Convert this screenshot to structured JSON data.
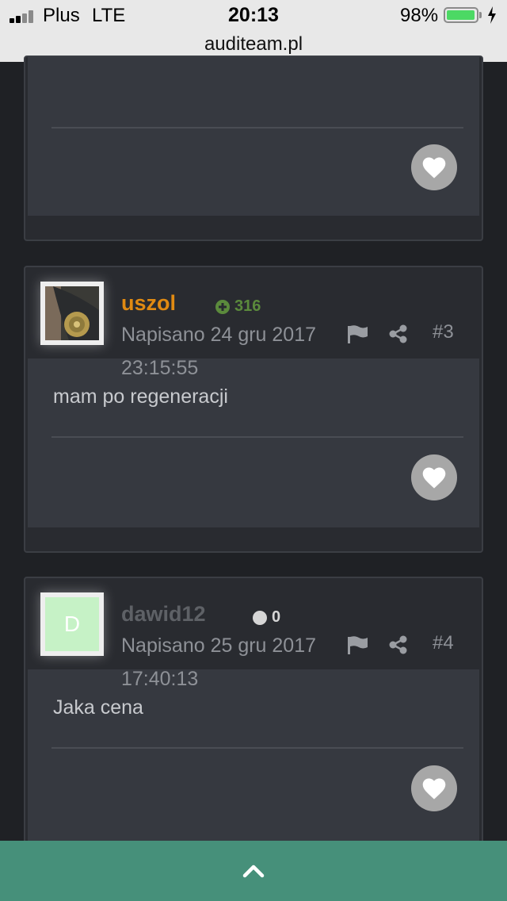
{
  "status_bar": {
    "carrier": "Plus",
    "network": "LTE",
    "time": "20:13",
    "battery_percent": "98%",
    "battery_level": 0.98,
    "battery_color": "#4cd964",
    "url": "auditeam.pl"
  },
  "posts": [
    {
      "id": "post-2",
      "content": ""
    },
    {
      "id": "post-3",
      "username": "uszol",
      "username_color": "#e08a12",
      "reputation": "316",
      "reputation_color": "#5b8a3c",
      "reputation_icon": "plus-circle-icon",
      "date_line1": "Napisano 24 gru 2017",
      "date_line2": "23:15:55",
      "number": "#3",
      "content": "mam po regeneracji",
      "avatar": "photo-avatar"
    },
    {
      "id": "post-4",
      "username": "dawid12",
      "username_color": "#5e6166",
      "reputation": "0",
      "reputation_color": "#d6d6d6",
      "reputation_icon": "neutral-dot-icon",
      "date_line1": "Napisano 25 gru 2017",
      "date_line2": "17:40:13",
      "number": "#4",
      "content": "Jaka cena",
      "avatar_letter": "D",
      "avatar_color": "#c6f2c6"
    }
  ],
  "bottom_bar": {
    "icon": "chevron-up-icon",
    "color": "#46907a"
  }
}
